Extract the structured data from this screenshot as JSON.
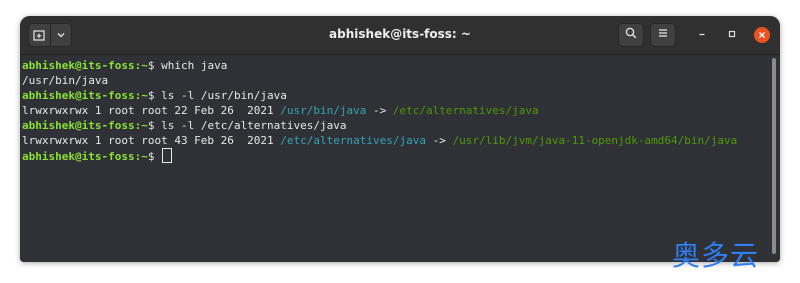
{
  "window": {
    "title": "abhishek@its-foss: ~"
  },
  "terminal": {
    "prompt_user": "abhishek@its-foss",
    "prompt_path": ":~",
    "prompt_symbol": "$ ",
    "commands": [
      "which java",
      "ls -l /usr/bin/java",
      "ls -l /etc/alternatives/java"
    ],
    "output": {
      "which_result": "/usr/bin/java",
      "ls1": {
        "meta": "lrwxrwxrwx 1 root root 22 Feb 26  2021 ",
        "link": "/usr/bin/java",
        "arrow": " -> ",
        "target": "/etc/alternatives/java"
      },
      "ls2": {
        "meta": "lrwxrwxrwx 1 root root 43 Feb 26  2021 ",
        "link": "/etc/alternatives/java",
        "arrow": " -> ",
        "target": "/usr/lib/jvm/java-11-openjdk-amd64/bin/java"
      }
    }
  },
  "watermark": {
    "text": "奥多云"
  },
  "colors": {
    "prompt_green": "#8ae234",
    "symlink_cyan": "#34a4b4",
    "target_green": "#4e9a06",
    "close_orange": "#e95420",
    "watermark_blue": "#2f7ff0"
  },
  "icons": {
    "new_tab": "new-tab-icon",
    "dropdown": "chevron-down-icon",
    "search": "search-icon",
    "menu": "hamburger-menu-icon",
    "minimize": "minimize-icon",
    "maximize": "maximize-icon",
    "close": "close-icon"
  }
}
